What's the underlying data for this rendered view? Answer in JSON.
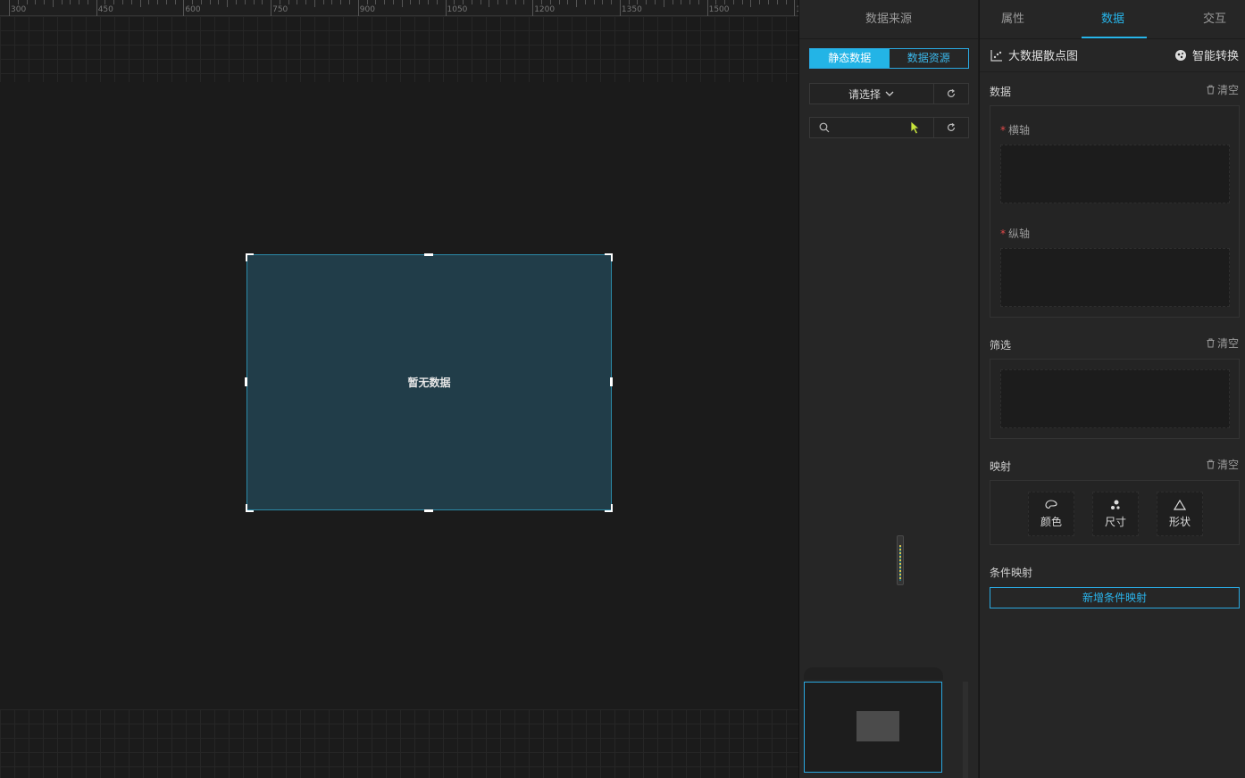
{
  "ruler": {
    "ticks": [
      "300",
      "450",
      "600",
      "750",
      "900",
      "1050",
      "1200",
      "1350",
      "1500",
      "1"
    ]
  },
  "canvas": {
    "empty_text": "暂无数据"
  },
  "data_source": {
    "title": "数据来源",
    "segments": [
      "静态数据",
      "数据资源"
    ],
    "active_segment": "静态数据",
    "select_value": "请选择",
    "search_placeholder": ""
  },
  "right_panel": {
    "tabs": [
      "属性",
      "数据",
      "交互"
    ],
    "active_tab": "数据",
    "chart_name": "大数据散点图",
    "smart_convert": "智能转换",
    "sections": {
      "data": {
        "label": "数据",
        "clear": "清空"
      },
      "x_axis": {
        "label": "横轴",
        "required_mark": "*"
      },
      "y_axis": {
        "label": "纵轴",
        "required_mark": "*"
      },
      "filter": {
        "label": "筛选",
        "clear": "清空"
      },
      "mapping": {
        "label": "映射",
        "clear": "清空",
        "buttons": [
          "颜色",
          "尺寸",
          "形状"
        ]
      },
      "condition_mapping": {
        "label": "条件映射",
        "add_button": "新增条件映射"
      }
    }
  },
  "icons": [
    "search-icon",
    "refresh-icon",
    "chevron-down-icon",
    "scatter-chart-icon",
    "brain-icon",
    "trash-icon",
    "palette-icon",
    "dots-icon",
    "triangle-icon",
    "cursor-icon"
  ],
  "colors": {
    "accent": "#27b5ea",
    "component_bg": "#213d49",
    "required": "#e04a4a"
  }
}
